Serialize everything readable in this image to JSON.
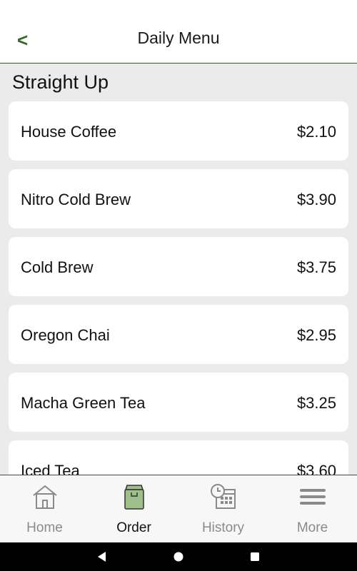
{
  "header": {
    "back_label": "<",
    "title": "Daily Menu"
  },
  "section": {
    "title": "Straight Up"
  },
  "menu_items": [
    {
      "name": "House Coffee",
      "price": "$2.10"
    },
    {
      "name": "Nitro Cold Brew",
      "price": "$3.90"
    },
    {
      "name": "Cold Brew",
      "price": "$3.75"
    },
    {
      "name": "Oregon Chai",
      "price": "$2.95"
    },
    {
      "name": "Macha Green Tea",
      "price": "$3.25"
    },
    {
      "name": "Iced Tea",
      "price": "$3.60"
    }
  ],
  "bottom_nav": {
    "items": [
      {
        "label": "Home",
        "icon": "home-icon"
      },
      {
        "label": "Order",
        "icon": "bag-icon",
        "active": true
      },
      {
        "label": "History",
        "icon": "history-calendar-icon"
      },
      {
        "label": "More",
        "icon": "menu-icon"
      }
    ]
  },
  "colors": {
    "accent_green": "#2e6b1f",
    "order_icon_fill": "#9fc08a",
    "inactive_gray": "#8a8a8a"
  }
}
